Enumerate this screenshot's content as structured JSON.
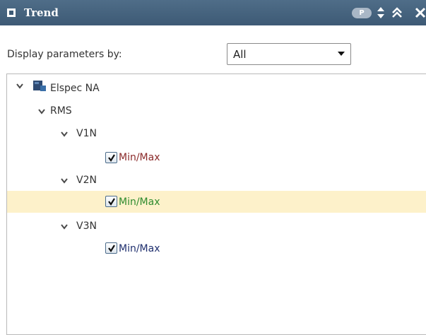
{
  "window": {
    "title": "Trend",
    "badge": "P"
  },
  "filter": {
    "label": "Display parameters by:",
    "selected": "All"
  },
  "tree": {
    "root": {
      "label": "Elspec NA",
      "expanded": true,
      "children": [
        {
          "label": "RMS",
          "expanded": true,
          "children": [
            {
              "label": "V1N",
              "item": {
                "label": "Min/Max",
                "checked": true,
                "color": "#8b2a2a"
              }
            },
            {
              "label": "V2N",
              "item": {
                "label": "Min/Max",
                "checked": true,
                "color": "#2e8b2e",
                "highlighted": true
              }
            },
            {
              "label": "V3N",
              "item": {
                "label": "Min/Max",
                "checked": true,
                "color": "#1f2f6e"
              }
            }
          ]
        }
      ]
    }
  },
  "colors": {
    "titlebar": "#3d5a75",
    "highlight_row": "#fdf1ca"
  }
}
